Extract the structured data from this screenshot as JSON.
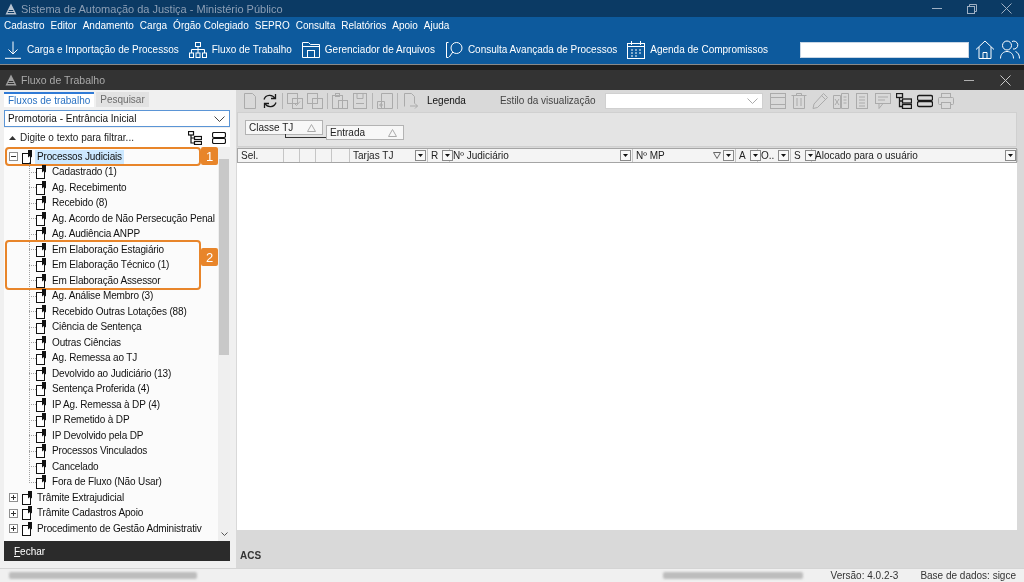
{
  "window": {
    "title": "Sistema de Automação da Justiça - Ministério Público"
  },
  "menu_bar": {
    "items": [
      "Cadastro",
      "Editor",
      "Andamento",
      "Carga",
      "Órgão Colegiado",
      "SEPRO",
      "Consulta",
      "Relatórios",
      "Apoio",
      "Ajuda"
    ]
  },
  "toolbar": {
    "buttons": [
      {
        "label": "Carga e Importação de Processos"
      },
      {
        "label": "Fluxo de Trabalho"
      },
      {
        "label": "Gerenciador de Arquivos"
      },
      {
        "label": "Consulta Avançada de Processos"
      },
      {
        "label": "Agenda de Compromissos"
      }
    ]
  },
  "child_window": {
    "title": "Fluxo de Trabalho"
  },
  "left_panel": {
    "tabs": [
      {
        "label": "Fluxos de trabalho",
        "selected": true
      },
      {
        "label": "Pesquisar",
        "selected": false
      }
    ],
    "flow_select": {
      "value": "Promotoria - Entrância Inicial"
    },
    "filter": {
      "placeholder": "Digite o texto para filtrar..."
    },
    "tree": [
      {
        "label": "Processos Judiciais",
        "expanded": true,
        "selected": true,
        "callout": "1",
        "children": [
          {
            "kind": "item",
            "label": "Cadastrado (1)",
            "selected": false
          },
          {
            "kind": "item",
            "label": "Ag. Recebimento",
            "selected": false
          },
          {
            "kind": "item",
            "label": "Recebido (8)",
            "selected": false
          },
          {
            "kind": "item",
            "label": "Ag. Acordo de Não Persecução Penal",
            "selected": false
          },
          {
            "kind": "item",
            "label": "Ag. Audiência ANPP",
            "selected": false
          },
          {
            "kind": "callout",
            "number": "2",
            "items": [
              {
                "kind": "item",
                "label": "Em Elaboração Estagiário",
                "selected": false
              },
              {
                "kind": "item",
                "label": "Em Elaboração Técnico (1)",
                "selected": false
              },
              {
                "kind": "item",
                "label": "Em Elaboração Assessor",
                "selected": false
              }
            ]
          },
          {
            "kind": "item",
            "label": "Ag. Análise Membro (3)",
            "selected": false
          },
          {
            "kind": "item",
            "label": "Recebido Outras Lotações (88)",
            "selected": false
          },
          {
            "kind": "item",
            "label": "Ciência de Sentença",
            "selected": false
          },
          {
            "kind": "item",
            "label": "Outras Ciências",
            "selected": false
          },
          {
            "kind": "item",
            "label": "Ag. Remessa ao TJ",
            "selected": false
          },
          {
            "kind": "item",
            "label": "Devolvido ao Judiciário (13)",
            "selected": false
          },
          {
            "kind": "item",
            "label": "Sentença Proferida (4)",
            "selected": false
          },
          {
            "kind": "item",
            "label": "IP Ag. Remessa à DP (4)",
            "selected": false
          },
          {
            "kind": "item",
            "label": "IP Remetido à DP",
            "selected": false
          },
          {
            "kind": "item",
            "label": "IP Devolvido pela DP",
            "selected": false
          },
          {
            "kind": "item",
            "label": "Processos Vinculados",
            "selected": false
          },
          {
            "kind": "item",
            "label": "Cancelado",
            "selected": false
          },
          {
            "kind": "item",
            "label": "Fora de Fluxo (Não Usar)",
            "selected": false
          }
        ]
      },
      {
        "label": "Trâmite Extrajudicial",
        "expanded": false,
        "selected": false
      },
      {
        "label": "Trâmite Cadastros Apoio",
        "expanded": false,
        "selected": false
      },
      {
        "label": "Procedimento de Gestão Administrativ",
        "expanded": false,
        "selected": false
      }
    ],
    "close_button": {
      "label": "Fechar"
    }
  },
  "grid": {
    "toolbar": {
      "left_buttons": [
        {
          "disabled": true
        },
        {
          "disabled": false
        },
        {
          "disabled": true
        },
        {
          "disabled": true
        },
        {
          "disabled": true
        },
        {
          "disabled": true
        },
        {
          "disabled": true
        },
        {
          "disabled": true
        }
      ],
      "legend_label": "Legenda",
      "view_style_label": "Estilo da visualização",
      "right_buttons": [
        {
          "disabled": true
        },
        {
          "disabled": true
        },
        {
          "disabled": true
        },
        {
          "disabled": true
        },
        {
          "disabled": true
        },
        {
          "disabled": true
        },
        {
          "disabled": false
        },
        {
          "disabled": false
        },
        {
          "disabled": true
        }
      ]
    },
    "group_by": [
      {
        "label": "Classe TJ"
      },
      {
        "label": "Entrada"
      }
    ],
    "columns": [
      {
        "kind": "text",
        "label": "Sel.",
        "menu": false,
        "filtered": false
      },
      {
        "kind": "blank"
      },
      {
        "kind": "blank"
      },
      {
        "kind": "blank"
      },
      {
        "kind": "blank"
      },
      {
        "kind": "text",
        "label": "Tarjas TJ",
        "menu": true,
        "filtered": false
      },
      {
        "kind": "text",
        "label": "R",
        "menu": true,
        "filtered": false
      },
      {
        "kind": "text",
        "label": "Nº Judiciário",
        "menu": true,
        "filtered": false
      },
      {
        "kind": "text",
        "label": "Nº MP",
        "menu": true,
        "filtered": true
      },
      {
        "kind": "text",
        "label": "A",
        "menu": true,
        "filtered": false
      },
      {
        "kind": "text",
        "label": "O..",
        "menu": true,
        "filtered": false
      },
      {
        "kind": "text",
        "label": "S",
        "menu": true,
        "filtered": false
      },
      {
        "kind": "text",
        "label": "Alocado para o usuário",
        "menu": true,
        "filtered": false
      }
    ],
    "footer_label": "ACS"
  },
  "status_bar": {
    "version": "Versão: 4.0.2-3",
    "database": "Base de dados: sigce"
  }
}
